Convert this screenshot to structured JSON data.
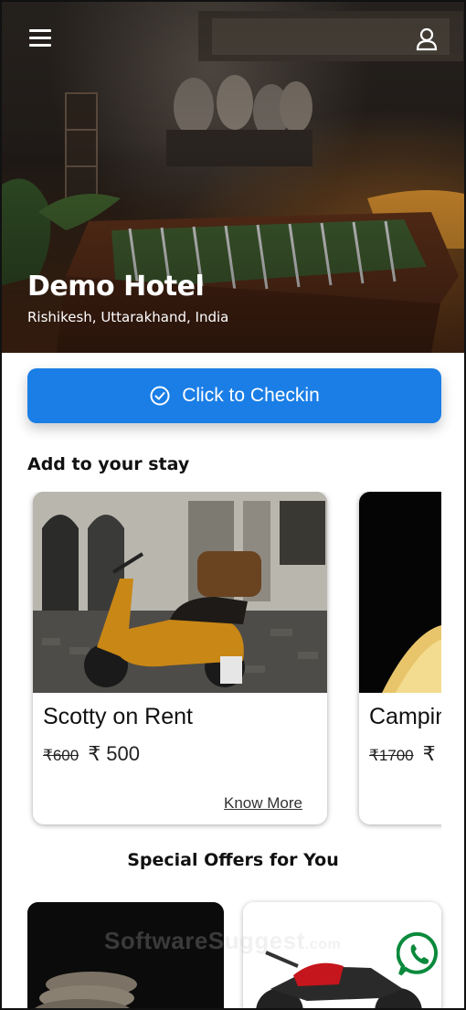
{
  "hero": {
    "hotel_name": "Demo Hotel",
    "location": "Rishikesh, Uttarakhand, India"
  },
  "checkin": {
    "label": "Click to Checkin"
  },
  "add_to_stay": {
    "title": "Add to your stay",
    "items": [
      {
        "title": "Scotty on Rent",
        "old_price": "₹600",
        "new_price": "₹ 500",
        "link": "Know More"
      },
      {
        "title": "Camping",
        "old_price": "₹1700",
        "new_price": "₹",
        "link": ""
      }
    ]
  },
  "offers": {
    "title": "Special Offers for You"
  },
  "watermark": {
    "text": "SoftwareSuggest",
    "suffix": ".com"
  },
  "colors": {
    "accent": "#1a7ee6",
    "whatsapp": "#0a8a3c"
  },
  "icons": {
    "menu": "hamburger-icon",
    "user": "user-icon",
    "checkin": "check-circle-icon",
    "chat": "whatsapp-icon"
  }
}
